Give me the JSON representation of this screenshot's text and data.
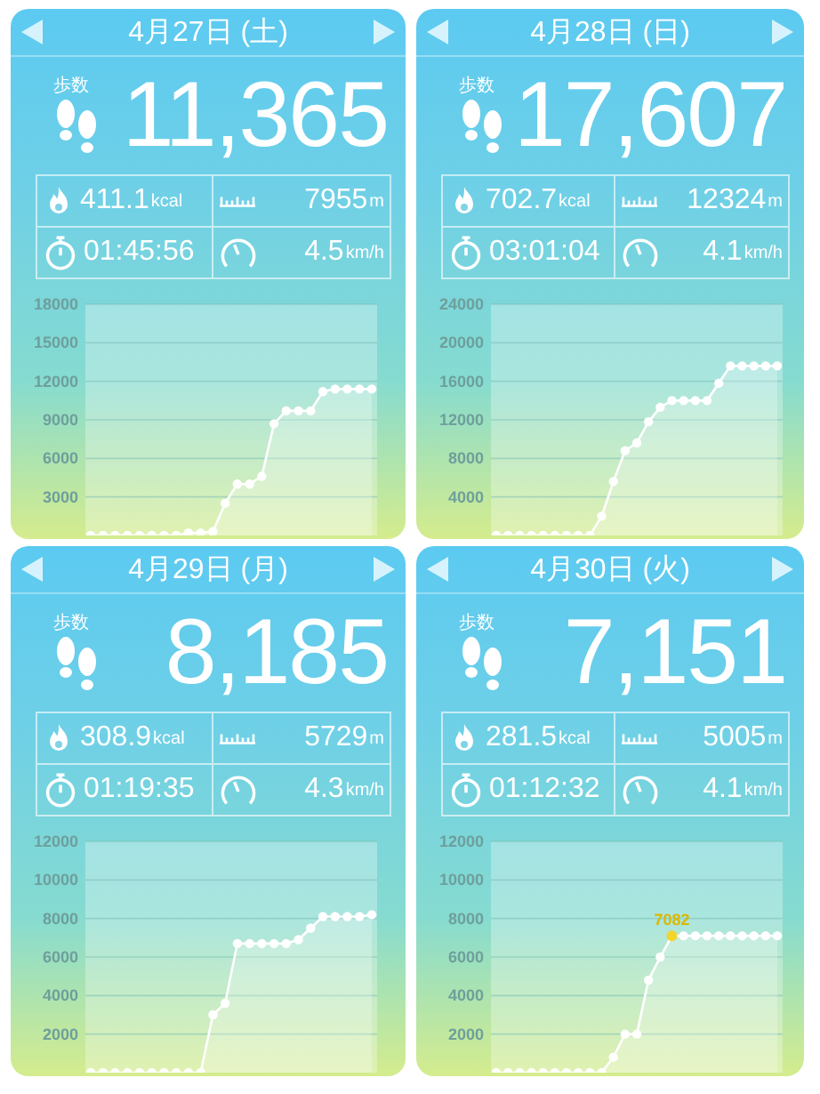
{
  "days": [
    {
      "date": "4月27日 (土)",
      "steps_label": "歩数",
      "steps": "11,365",
      "calories": {
        "value": "411.1",
        "unit": "kcal"
      },
      "distance": {
        "value": "7955",
        "unit": "m"
      },
      "duration": "01:45:56",
      "speed": {
        "value": "4.5",
        "unit": "km/h"
      },
      "chart_data": {
        "type": "area",
        "grid": true,
        "ylim": [
          0,
          18000
        ],
        "yticks": [
          3000,
          6000,
          9000,
          12000,
          15000,
          18000
        ],
        "series": [
          {
            "color": "#ffffff",
            "marker": true,
            "values": [
              0,
              0,
              0,
              0,
              0,
              0,
              0,
              0,
              200,
              200,
              300,
              2500,
              4000,
              4000,
              4600,
              8700,
              9700,
              9700,
              9700,
              11200,
              11400,
              11400,
              11400,
              11400
            ]
          }
        ]
      }
    },
    {
      "date": "4月28日 (日)",
      "steps_label": "歩数",
      "steps": "17,607",
      "calories": {
        "value": "702.7",
        "unit": "kcal"
      },
      "distance": {
        "value": "12324",
        "unit": "m"
      },
      "duration": "03:01:04",
      "speed": {
        "value": "4.1",
        "unit": "km/h"
      },
      "chart_data": {
        "type": "area",
        "grid": true,
        "ylim": [
          0,
          24000
        ],
        "yticks": [
          4000,
          8000,
          12000,
          16000,
          20000,
          24000
        ],
        "series": [
          {
            "color": "#ffffff",
            "marker": true,
            "values": [
              0,
              0,
              0,
              0,
              0,
              0,
              0,
              0,
              0,
              2000,
              5600,
              8800,
              9600,
              11800,
              13300,
              14000,
              14000,
              14000,
              14000,
              15800,
              17600,
              17600,
              17600,
              17600,
              17600
            ]
          }
        ]
      }
    },
    {
      "date": "4月29日 (月)",
      "steps_label": "歩数",
      "steps": "8,185",
      "calories": {
        "value": "308.9",
        "unit": "kcal"
      },
      "distance": {
        "value": "5729",
        "unit": "m"
      },
      "duration": "01:19:35",
      "speed": {
        "value": "4.3",
        "unit": "km/h"
      },
      "chart_data": {
        "type": "area",
        "grid": true,
        "ylim": [
          0,
          12000
        ],
        "yticks": [
          2000,
          4000,
          6000,
          8000,
          10000,
          12000
        ],
        "series": [
          {
            "color": "#ffffff",
            "marker": true,
            "values": [
              0,
              0,
              0,
              0,
              0,
              0,
              0,
              0,
              0,
              0,
              3000,
              3600,
              6700,
              6700,
              6700,
              6700,
              6700,
              6900,
              7500,
              8100,
              8100,
              8100,
              8100,
              8200
            ]
          }
        ]
      }
    },
    {
      "date": "4月30日 (火)",
      "steps_label": "歩数",
      "steps": "7,151",
      "calories": {
        "value": "281.5",
        "unit": "kcal"
      },
      "distance": {
        "value": "5005",
        "unit": "m"
      },
      "duration": "01:12:32",
      "speed": {
        "value": "4.1",
        "unit": "km/h"
      },
      "chart_data": {
        "type": "area",
        "grid": true,
        "ylim": [
          0,
          12000
        ],
        "yticks": [
          2000,
          4000,
          6000,
          8000,
          10000,
          12000
        ],
        "series": [
          {
            "color": "#ffffff",
            "marker": true,
            "values": [
              0,
              0,
              0,
              0,
              0,
              0,
              0,
              0,
              0,
              0,
              800,
              2000,
              2000,
              4800,
              6000,
              7100,
              7100,
              7100,
              7100,
              7100,
              7100,
              7100,
              7100,
              7100,
              7100
            ]
          }
        ],
        "annotations": [
          {
            "text": "7082",
            "y": 7100
          }
        ]
      }
    }
  ]
}
